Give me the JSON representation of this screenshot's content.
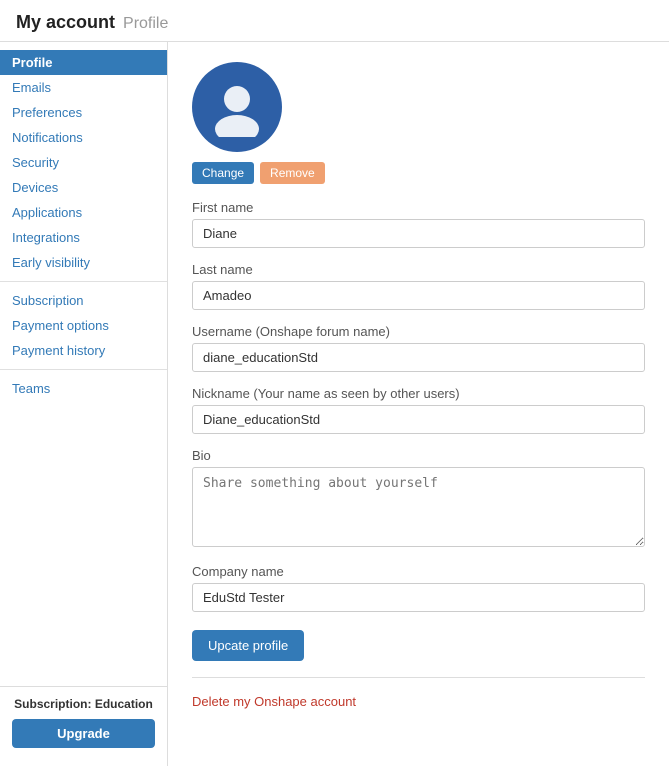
{
  "header": {
    "my_account": "My account",
    "profile": "Profile"
  },
  "sidebar": {
    "items_top": [
      {
        "id": "profile",
        "label": "Profile",
        "active": true
      },
      {
        "id": "emails",
        "label": "Emails",
        "active": false
      },
      {
        "id": "preferences",
        "label": "Preferences",
        "active": false
      },
      {
        "id": "notifications",
        "label": "Notifications",
        "active": false
      },
      {
        "id": "security",
        "label": "Security",
        "active": false
      },
      {
        "id": "devices",
        "label": "Devices",
        "active": false
      },
      {
        "id": "applications",
        "label": "Applications",
        "active": false
      },
      {
        "id": "integrations",
        "label": "Integrations",
        "active": false
      },
      {
        "id": "early-visibility",
        "label": "Early visibility",
        "active": false
      }
    ],
    "items_mid": [
      {
        "id": "subscription",
        "label": "Subscription",
        "active": false
      },
      {
        "id": "payment-options",
        "label": "Payment options",
        "active": false
      },
      {
        "id": "payment-history",
        "label": "Payment history",
        "active": false
      }
    ],
    "items_bottom": [
      {
        "id": "teams",
        "label": "Teams",
        "active": false
      }
    ],
    "subscription_label": "Subscription: Education",
    "upgrade_label": "Upgrade"
  },
  "main": {
    "avatar_change_label": "Change",
    "avatar_remove_label": "Remove",
    "first_name_label": "First name",
    "first_name_value": "Diane",
    "last_name_label": "Last name",
    "last_name_value": "Amadeo",
    "username_label": "Username (Onshape forum name)",
    "username_value": "diane_educationStd",
    "nickname_label": "Nickname (Your name as seen by other users)",
    "nickname_value": "Diane_educationStd",
    "bio_label": "Bio",
    "bio_placeholder": "Share something about yourself",
    "company_label": "Company name",
    "company_value": "EduStd Tester",
    "update_button_label": "Upcate profile",
    "delete_label": "Delete my Onshape account"
  }
}
